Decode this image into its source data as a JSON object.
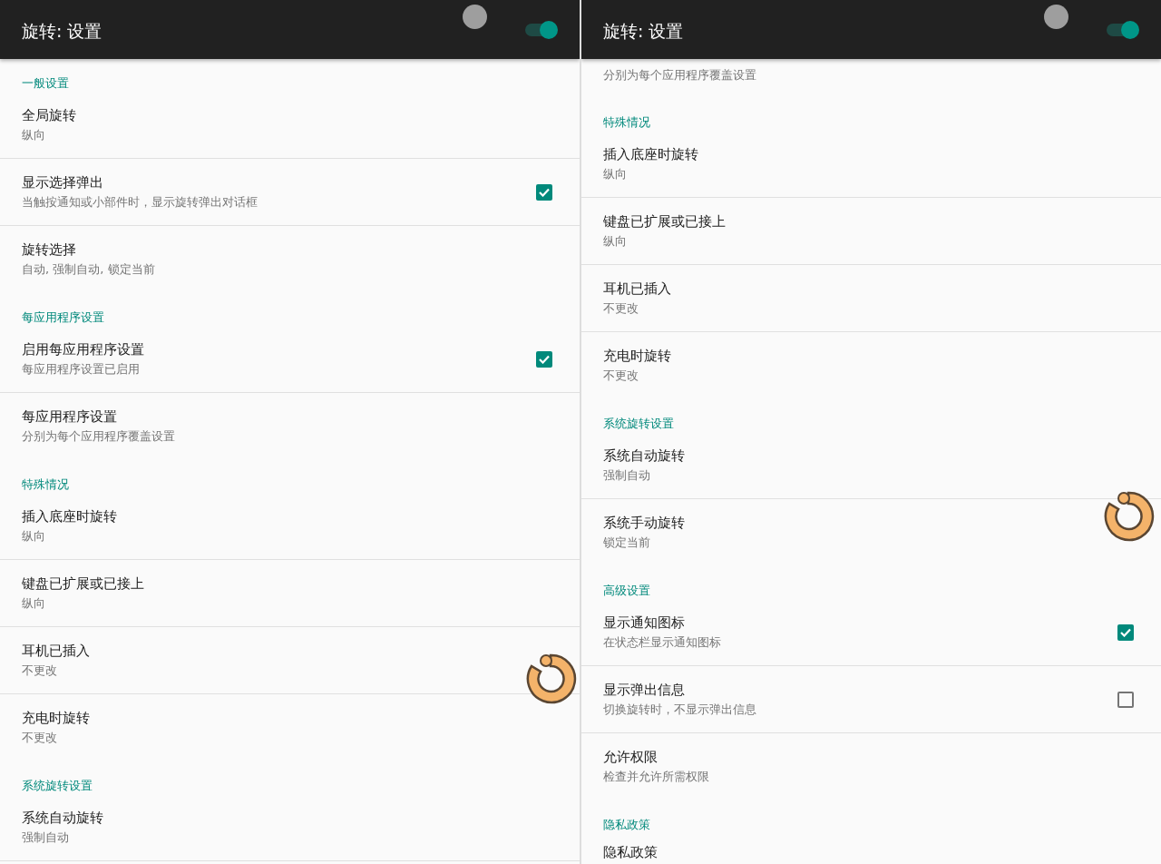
{
  "screens": [
    {
      "title": "旋转: 设置",
      "toggle_on": true,
      "items": [
        {
          "kind": "section",
          "title": "一般设置"
        },
        {
          "kind": "item",
          "title": "全局旋转",
          "subtitle": "纵向",
          "divider": true
        },
        {
          "kind": "checkbox",
          "title": "显示选择弹出",
          "subtitle": "当触按通知或小部件时，显示旋转弹出对话框",
          "checked": true,
          "divider": true
        },
        {
          "kind": "item",
          "title": "旋转选择",
          "subtitle": "自动, 强制自动, 锁定当前",
          "divider": false
        },
        {
          "kind": "section",
          "title": "每应用程序设置"
        },
        {
          "kind": "checkbox",
          "title": "启用每应用程序设置",
          "subtitle": "每应用程序设置已启用",
          "checked": true,
          "divider": true
        },
        {
          "kind": "item",
          "title": "每应用程序设置",
          "subtitle": "分别为每个应用程序覆盖设置",
          "divider": false
        },
        {
          "kind": "section",
          "title": "特殊情况"
        },
        {
          "kind": "item",
          "title": "插入底座时旋转",
          "subtitle": "纵向",
          "divider": true
        },
        {
          "kind": "item",
          "title": "键盘已扩展或已接上",
          "subtitle": "纵向",
          "divider": true
        },
        {
          "kind": "item",
          "title": "耳机已插入",
          "subtitle": "不更改",
          "divider": true
        },
        {
          "kind": "item",
          "title": "充电时旋转",
          "subtitle": "不更改",
          "divider": false
        },
        {
          "kind": "section",
          "title": "系统旋转设置"
        },
        {
          "kind": "item",
          "title": "系统自动旋转",
          "subtitle": "强制自动",
          "divider": true
        }
      ]
    },
    {
      "title": "旋转: 设置",
      "toggle_on": true,
      "items": [
        {
          "kind": "partial",
          "subtitle": "分别为每个应用程序覆盖设置"
        },
        {
          "kind": "section",
          "title": "特殊情况"
        },
        {
          "kind": "item",
          "title": "插入底座时旋转",
          "subtitle": "纵向",
          "divider": true
        },
        {
          "kind": "item",
          "title": "键盘已扩展或已接上",
          "subtitle": "纵向",
          "divider": true
        },
        {
          "kind": "item",
          "title": "耳机已插入",
          "subtitle": "不更改",
          "divider": true
        },
        {
          "kind": "item",
          "title": "充电时旋转",
          "subtitle": "不更改",
          "divider": false
        },
        {
          "kind": "section",
          "title": "系统旋转设置"
        },
        {
          "kind": "item",
          "title": "系统自动旋转",
          "subtitle": "强制自动",
          "divider": true
        },
        {
          "kind": "item",
          "title": "系统手动旋转",
          "subtitle": "锁定当前",
          "divider": false
        },
        {
          "kind": "section",
          "title": "高级设置"
        },
        {
          "kind": "checkbox",
          "title": "显示通知图标",
          "subtitle": "在状态栏显示通知图标",
          "checked": true,
          "divider": true
        },
        {
          "kind": "checkbox",
          "title": "显示弹出信息",
          "subtitle": "切换旋转时，不显示弹出信息",
          "checked": false,
          "divider": true
        },
        {
          "kind": "item",
          "title": "允许权限",
          "subtitle": "检查并允许所需权限",
          "divider": false
        },
        {
          "kind": "section",
          "title": "隐私政策"
        },
        {
          "kind": "partial_title",
          "title": "隐私政策"
        }
      ]
    }
  ]
}
